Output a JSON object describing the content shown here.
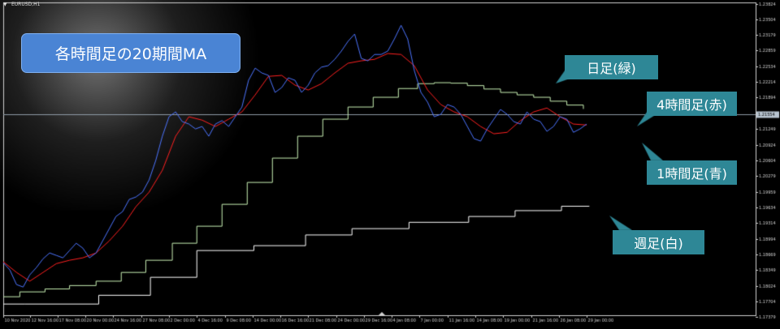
{
  "window": {
    "symbol": "EURUSD,H1"
  },
  "annotations": {
    "title": "各時間足の20期間MA",
    "daily": "日足(緑)",
    "h4": "4時間足(赤)",
    "h1": "1時間足(青)",
    "weekly": "週足(白)"
  },
  "price_line": {
    "value": 1.2155,
    "label": "1.21554",
    "color": "#8e9aa6"
  },
  "chart_data": {
    "type": "line",
    "title": "",
    "xlabel": "",
    "ylabel": "",
    "ylim": [
      1.1742,
      1.2385
    ],
    "x_range": [
      0,
      100
    ],
    "grid": false,
    "legend": "none",
    "x_ticks": [
      {
        "x": 0,
        "label": "10 Nov 2020"
      },
      {
        "x": 4,
        "label": "12 Nov 16:00"
      },
      {
        "x": 8.2,
        "label": "17 Nov 08:00"
      },
      {
        "x": 12.4,
        "label": "20 Nov 00:00"
      },
      {
        "x": 16.6,
        "label": "24 Nov 16:00"
      },
      {
        "x": 20.8,
        "label": "27 Nov 08:00"
      },
      {
        "x": 25,
        "label": "2 Dec 00:00"
      },
      {
        "x": 29.2,
        "label": "4 Dec 16:00"
      },
      {
        "x": 33.4,
        "label": "9 Dec 08:00"
      },
      {
        "x": 37.6,
        "label": "14 Dec 00:00"
      },
      {
        "x": 41.8,
        "label": "16 Dec 16:00"
      },
      {
        "x": 46,
        "label": "21 Dec 08:00"
      },
      {
        "x": 50.2,
        "label": "24 Dec 00:00"
      },
      {
        "x": 54.4,
        "label": "29 Dec 16:00"
      },
      {
        "x": 58.6,
        "label": "4 Jan 08:00"
      },
      {
        "x": 62.8,
        "label": "7 Jan 00:00"
      },
      {
        "x": 67,
        "label": "11 Jan 16:00"
      },
      {
        "x": 71.2,
        "label": "14 Jan 08:00"
      },
      {
        "x": 75.4,
        "label": "19 Jan 00:00"
      },
      {
        "x": 79.6,
        "label": "21 Jan 16:00"
      },
      {
        "x": 83.8,
        "label": "26 Jan 08:00"
      },
      {
        "x": 88,
        "label": "29 Jan 00:00"
      }
    ],
    "y_ticks": [
      {
        "v": 1.23824,
        "label": "1.23824"
      },
      {
        "v": 1.23504,
        "label": "1.23504"
      },
      {
        "v": 1.23179,
        "label": "1.23179"
      },
      {
        "v": 1.22859,
        "label": "1.22859"
      },
      {
        "v": 1.22534,
        "label": "1.22534"
      },
      {
        "v": 1.22214,
        "label": "1.22214"
      },
      {
        "v": 1.21894,
        "label": "1.21894"
      },
      {
        "v": 1.21569,
        "label": "1.21569"
      },
      {
        "v": 1.21249,
        "label": "1.21249"
      },
      {
        "v": 1.20924,
        "label": "1.20924"
      },
      {
        "v": 1.20604,
        "label": "1.20604"
      },
      {
        "v": 1.20279,
        "label": "1.20279"
      },
      {
        "v": 1.19959,
        "label": "1.19959"
      },
      {
        "v": 1.19634,
        "label": "1.19634"
      },
      {
        "v": 1.19314,
        "label": "1.19314"
      },
      {
        "v": 1.18994,
        "label": "1.18994"
      },
      {
        "v": 1.18669,
        "label": "1.18669"
      },
      {
        "v": 1.18349,
        "label": "1.18349"
      },
      {
        "v": 1.18024,
        "label": "1.18024"
      },
      {
        "v": 1.17704,
        "label": "1.17704"
      },
      {
        "v": 1.17379,
        "label": "1.17379"
      }
    ],
    "series": [
      {
        "key": "weekly",
        "color": "#ffffff",
        "step": true,
        "x": [
          0,
          3.2,
          14.4,
          22.2,
          29.2,
          37.8,
          45.6,
          52.6,
          61.2,
          70.2,
          77.2,
          84.2,
          88.4
        ],
        "values": [
          1.1765,
          1.1765,
          1.1783,
          1.182,
          1.1875,
          1.1885,
          1.1907,
          1.192,
          1.1933,
          1.1945,
          1.1957,
          1.1966,
          1.1966
        ]
      },
      {
        "key": "daily",
        "color": "#c8f0b4",
        "step": true,
        "x": [
          0,
          2.5,
          6.3,
          10,
          14,
          17.8,
          21.5,
          25.5,
          29.2,
          33,
          36.8,
          40.6,
          44.4,
          48.2,
          52,
          55.8,
          59.6,
          62.5,
          65,
          67.5,
          70,
          72.5,
          75,
          77.5,
          80,
          82.5,
          85,
          87.5
        ],
        "values": [
          1.178,
          1.179,
          1.1796,
          1.1803,
          1.1812,
          1.183,
          1.1855,
          1.189,
          1.1925,
          1.197,
          1.2015,
          1.2065,
          1.211,
          1.2145,
          1.217,
          1.219,
          1.2208,
          1.2218,
          1.222,
          1.2219,
          1.2214,
          1.2207,
          1.22,
          1.2195,
          1.219,
          1.2182,
          1.2174,
          1.2166
        ]
      },
      {
        "key": "h4",
        "color": "#ff2020",
        "step": false,
        "x": [
          0,
          2,
          4,
          6,
          8,
          10,
          12,
          14,
          16,
          18,
          20,
          22,
          24,
          26,
          28,
          30,
          32,
          34,
          36,
          38,
          40,
          42,
          44,
          46,
          48,
          50,
          52,
          54,
          56,
          58,
          60,
          62,
          64,
          66,
          68,
          70,
          72,
          74,
          76,
          78,
          80,
          82,
          84,
          86,
          88
        ],
        "values": [
          1.1852,
          1.183,
          1.1812,
          1.183,
          1.1848,
          1.1855,
          1.186,
          1.187,
          1.1895,
          1.1925,
          1.1965,
          1.1995,
          1.204,
          1.211,
          1.215,
          1.2143,
          1.213,
          1.2145,
          1.216,
          1.2195,
          1.2233,
          1.2235,
          1.2215,
          1.2205,
          1.2218,
          1.224,
          1.226,
          1.2265,
          1.2268,
          1.228,
          1.2278,
          1.2255,
          1.2205,
          1.2175,
          1.216,
          1.215,
          1.213,
          1.2115,
          1.2118,
          1.2142,
          1.216,
          1.2168,
          1.215,
          1.2135,
          1.2133
        ]
      },
      {
        "key": "h1",
        "color": "#4c74ff",
        "step": false,
        "x": [
          0,
          1,
          2,
          3,
          4,
          5,
          6,
          7,
          8,
          9,
          10,
          11,
          12,
          13,
          14,
          15,
          16,
          17,
          18,
          19,
          20,
          21,
          22,
          23,
          24,
          25,
          26,
          27,
          28,
          29,
          30,
          31,
          32,
          33,
          34,
          35,
          36,
          37,
          38,
          39,
          40,
          41,
          42,
          43,
          44,
          45,
          46,
          47,
          48,
          49,
          50,
          51,
          52,
          53,
          54,
          55,
          56,
          57,
          58,
          59,
          60,
          61,
          62,
          63,
          64,
          65,
          66,
          67,
          68,
          69,
          70,
          71,
          72,
          73,
          74,
          75,
          76,
          77,
          78,
          79,
          80,
          81,
          82,
          83,
          84,
          85,
          86,
          87,
          88
        ],
        "values": [
          1.185,
          1.1835,
          1.1805,
          1.18,
          1.1825,
          1.184,
          1.1858,
          1.187,
          1.1865,
          1.186,
          1.1875,
          1.189,
          1.188,
          1.186,
          1.187,
          1.1895,
          1.192,
          1.1945,
          1.1955,
          1.198,
          1.1985,
          1.1995,
          1.202,
          1.206,
          1.211,
          1.215,
          1.216,
          1.214,
          1.2135,
          1.2125,
          1.213,
          1.211,
          1.2135,
          1.2142,
          1.213,
          1.215,
          1.217,
          1.2225,
          1.225,
          1.224,
          1.2235,
          1.22,
          1.221,
          1.223,
          1.2225,
          1.22,
          1.2215,
          1.224,
          1.2252,
          1.2255,
          1.2268,
          1.2285,
          1.2305,
          1.232,
          1.227,
          1.2265,
          1.2278,
          1.2278,
          1.2285,
          1.231,
          1.2338,
          1.231,
          1.2245,
          1.22,
          1.218,
          1.215,
          1.2155,
          1.2175,
          1.217,
          1.2155,
          1.213,
          1.2105,
          1.21,
          1.2125,
          1.2145,
          1.2165,
          1.2155,
          1.214,
          1.2135,
          1.216,
          1.2145,
          1.214,
          1.212,
          1.213,
          1.215,
          1.2145,
          1.2118,
          1.2125,
          1.2135
        ]
      }
    ]
  }
}
